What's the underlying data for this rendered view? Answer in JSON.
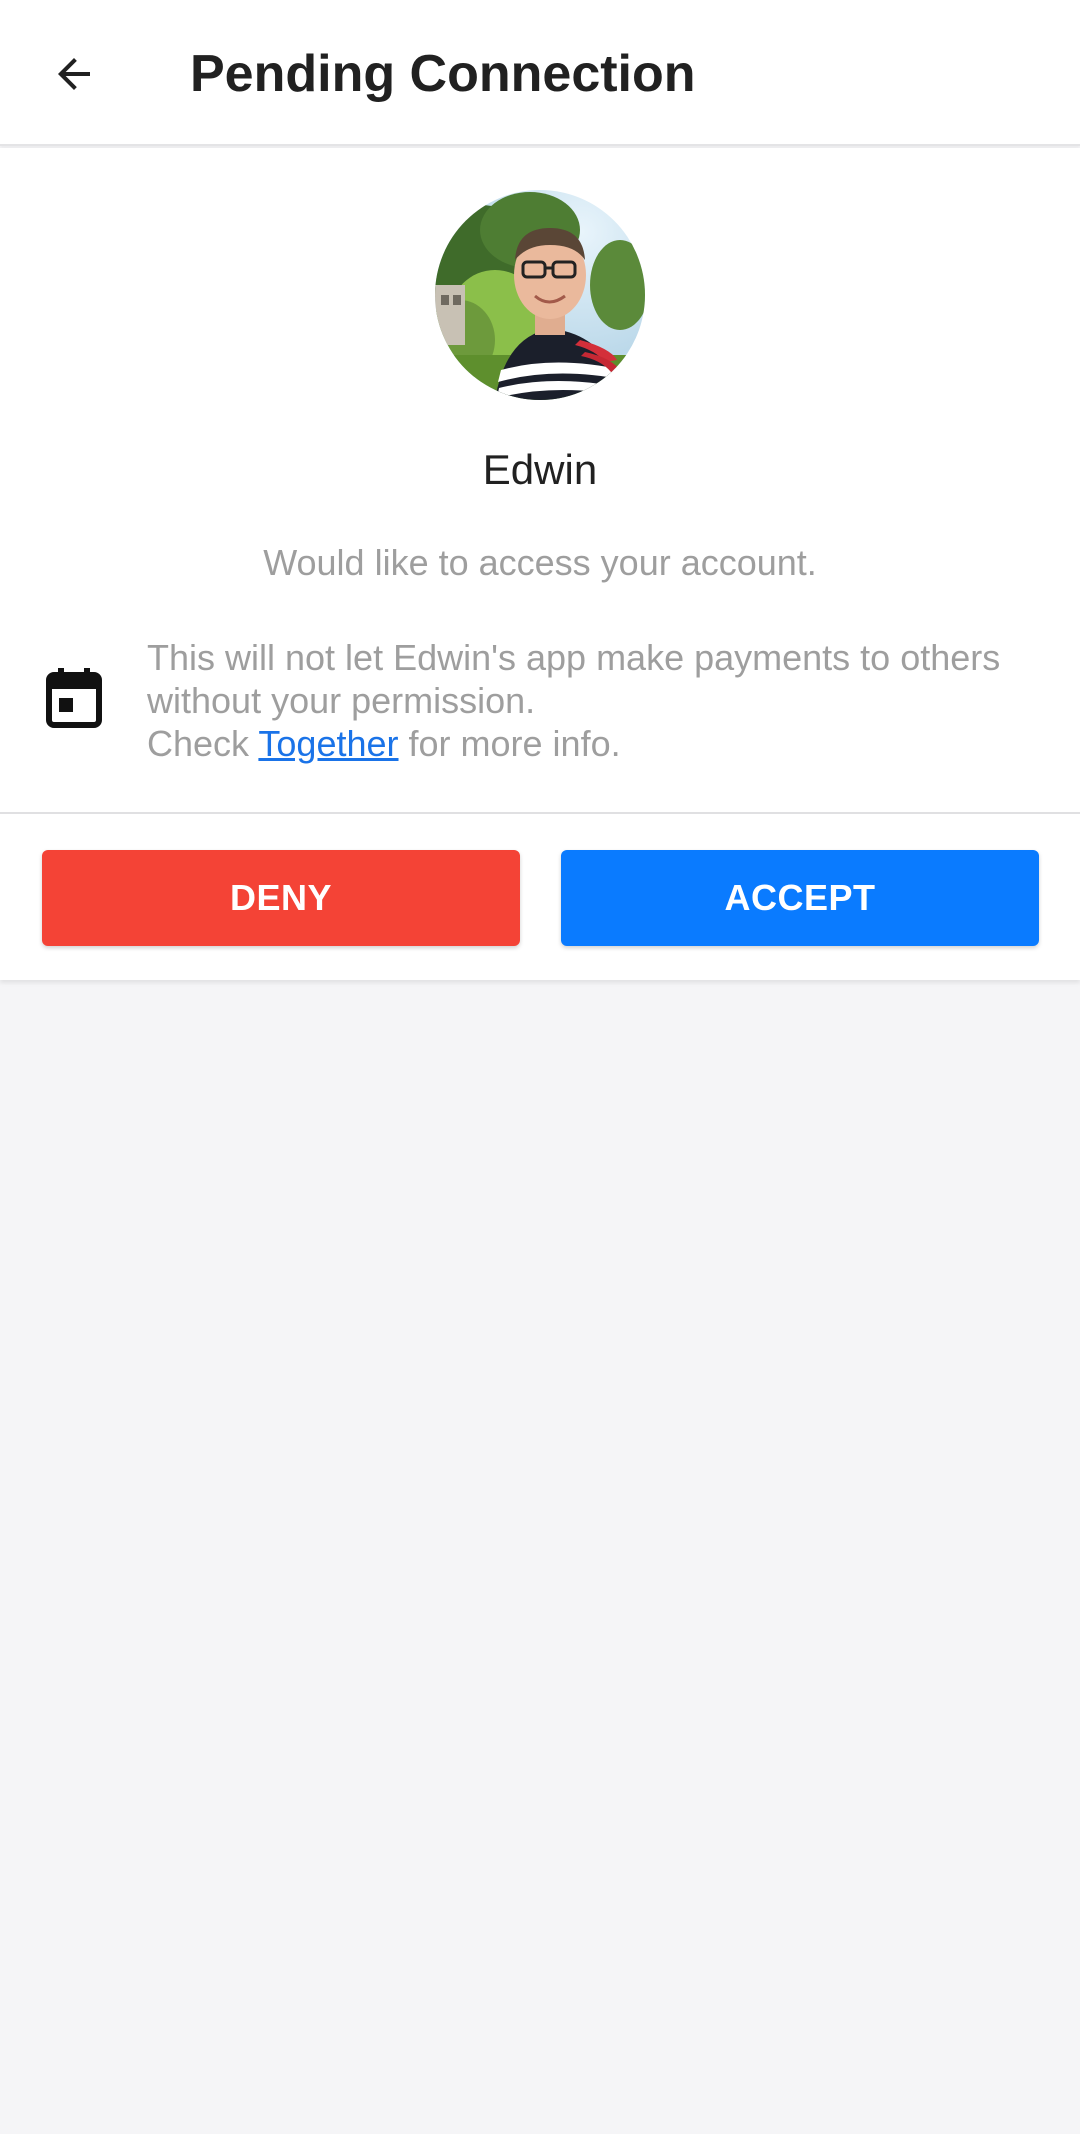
{
  "header": {
    "title": "Pending Connection",
    "back_icon": "arrow-left-icon"
  },
  "request": {
    "name": "Edwin",
    "subtitle": "Would like to access your account.",
    "info_line1": "This will not let Edwin's app make payments to others",
    "info_line2": "without your permission.",
    "info_check": "Check ",
    "info_link": "Together",
    "info_suffix": " for more info.",
    "info_icon": "calendar-icon"
  },
  "actions": {
    "deny_label": "DENY",
    "accept_label": "ACCEPT"
  },
  "colors": {
    "deny": "#f44336",
    "accept": "#0a7bff",
    "link": "#1a73e8",
    "muted_text": "#9e9e9e",
    "background": "#f5f5f7"
  }
}
